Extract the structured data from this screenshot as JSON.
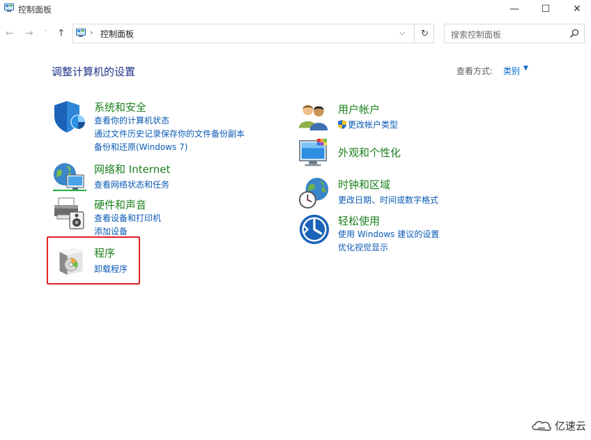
{
  "window": {
    "title": "控制面板",
    "minimize_glyph": "—",
    "maximize_glyph": "☐",
    "close_glyph": "✕"
  },
  "nav": {
    "back_glyph": "←",
    "forward_glyph": "→",
    "recent_glyph": "˅",
    "up_glyph": "↑",
    "address_separator": "›",
    "address_path": "控制面板",
    "address_dropdown_glyph": "⌵",
    "refresh_glyph": "↻",
    "search_placeholder": "搜索控制面板"
  },
  "main": {
    "heading": "调整计算机的设置",
    "view_by_label": "查看方式:",
    "view_by_value": "类别",
    "view_by_arrow": "▼"
  },
  "categories": {
    "system_security": {
      "title": "系统和安全",
      "links": [
        "查看你的计算机状态",
        "通过文件历史记录保存你的文件备份副本",
        "备份和还原(Windows 7)"
      ]
    },
    "network": {
      "title": "网络和 Internet",
      "links": [
        "查看网络状态和任务"
      ]
    },
    "hardware": {
      "title": "硬件和声音",
      "links": [
        "查看设备和打印机",
        "添加设备"
      ]
    },
    "programs": {
      "title": "程序",
      "links": [
        "卸载程序"
      ]
    },
    "user_accounts": {
      "title": "用户帐户",
      "links": [
        "更改帐户类型"
      ]
    },
    "appearance": {
      "title": "外观和个性化",
      "links": []
    },
    "clock_region": {
      "title": "时钟和区域",
      "links": [
        "更改日期、时间或数字格式"
      ]
    },
    "ease_of_access": {
      "title": "轻松使用",
      "links": [
        "使用 Windows 建议的设置",
        "优化视觉显示"
      ]
    }
  },
  "colors": {
    "category_title": "#1d7f1d",
    "link": "#0a5ab4",
    "heading": "#1e3287",
    "highlight": "#e01f1f"
  },
  "watermark": {
    "text": "亿速云"
  }
}
